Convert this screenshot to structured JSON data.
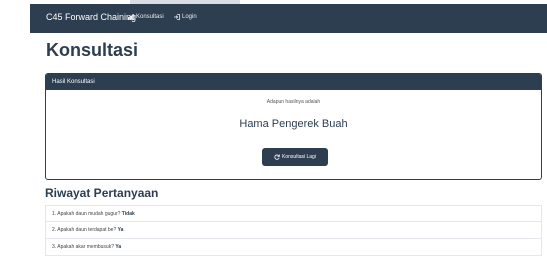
{
  "navbar": {
    "brand": "C45 Forward Chaining",
    "items": [
      {
        "label": "Konsultasi",
        "icon": "bar-chart-icon"
      },
      {
        "label": "Login",
        "icon": "login-icon"
      }
    ]
  },
  "page": {
    "title": "Konsultasi"
  },
  "result_panel": {
    "heading": "Hasil Konsultasi",
    "caption": "Adapun hasilnya adalah",
    "result": "Hama Pengerek Buah",
    "button_label": "Konsultasi Lagi",
    "button_icon": "refresh-icon"
  },
  "history": {
    "title": "Riwayat Pertanyaan",
    "items": [
      {
        "question": "1. Apakah daun mudah gugur?",
        "answer": "Tidak"
      },
      {
        "question": "2. Apakah daun terdapat be?",
        "answer": "Ya"
      },
      {
        "question": "3. Apakah akar membusuk?",
        "answer": "Ya"
      }
    ]
  },
  "colors": {
    "primary": "#2c3e50",
    "border": "#e4e7eb"
  }
}
